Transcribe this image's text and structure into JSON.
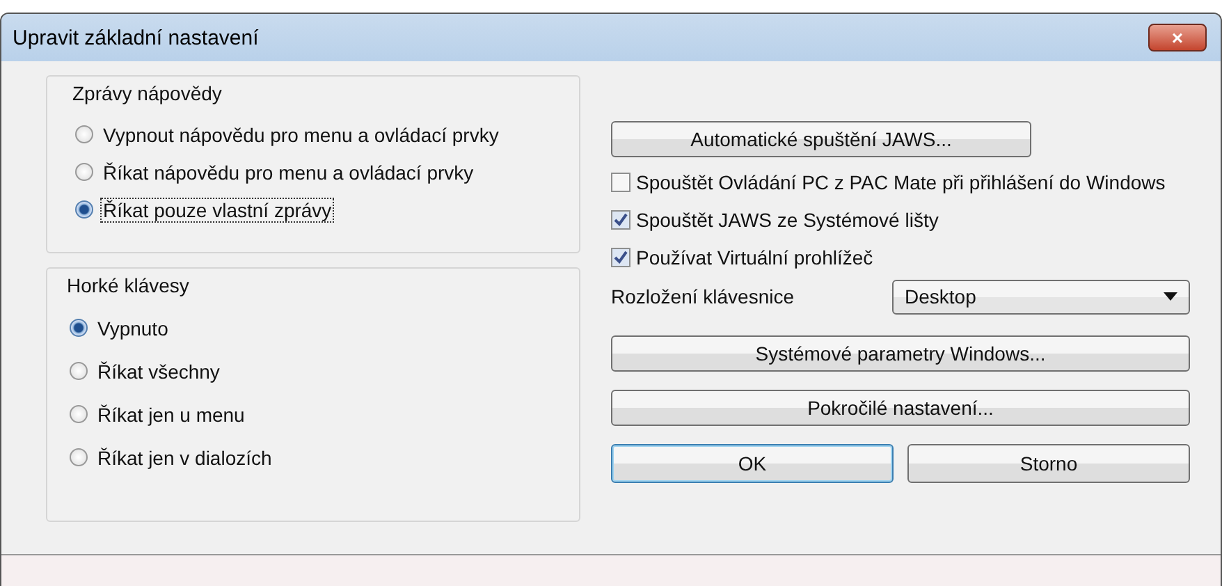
{
  "window": {
    "title": "Upravit základní nastavení",
    "close": "×"
  },
  "groups": [
    {
      "title": "Zprávy nápovědy",
      "items": [
        {
          "label": "Vypnout nápovědu pro menu a ovládací prvky",
          "selected": false,
          "focused": false
        },
        {
          "label": "Říkat nápovědu pro menu a ovládací prvky",
          "selected": false,
          "focused": false
        },
        {
          "label": "Říkat pouze vlastní zprávy",
          "selected": true,
          "focused": true
        }
      ]
    },
    {
      "title": "Horké klávesy",
      "items": [
        {
          "label": "Vypnuto",
          "selected": true,
          "focused": false
        },
        {
          "label": "Říkat všechny",
          "selected": false,
          "focused": false
        },
        {
          "label": "Říkat jen u menu",
          "selected": false,
          "focused": false
        },
        {
          "label": "Říkat jen v dialozích",
          "selected": false,
          "focused": false
        }
      ]
    }
  ],
  "right": [
    {
      "kind": "button",
      "label": "Automatické spuštění JAWS...",
      "full_width": false
    },
    {
      "kind": "checkbox",
      "label": "Spouštět Ovládání PC z PAC Mate při přihlášení do Windows",
      "checked": false
    },
    {
      "kind": "checkbox",
      "label": "Spouštět JAWS ze Systémové lišty",
      "checked": true
    },
    {
      "kind": "checkbox",
      "label": "Používat Virtuální prohlížeč",
      "checked": true
    },
    {
      "kind": "dropdown",
      "label": "Rozložení klávesnice",
      "value": "Desktop"
    },
    {
      "kind": "button",
      "label": "Systémové parametry Windows...",
      "full_width": true
    },
    {
      "kind": "button",
      "label": "Pokročilé nastavení...",
      "full_width": true
    }
  ],
  "dialog_buttons": [
    {
      "label": "OK",
      "default": true
    },
    {
      "label": "Storno",
      "default": false
    }
  ]
}
